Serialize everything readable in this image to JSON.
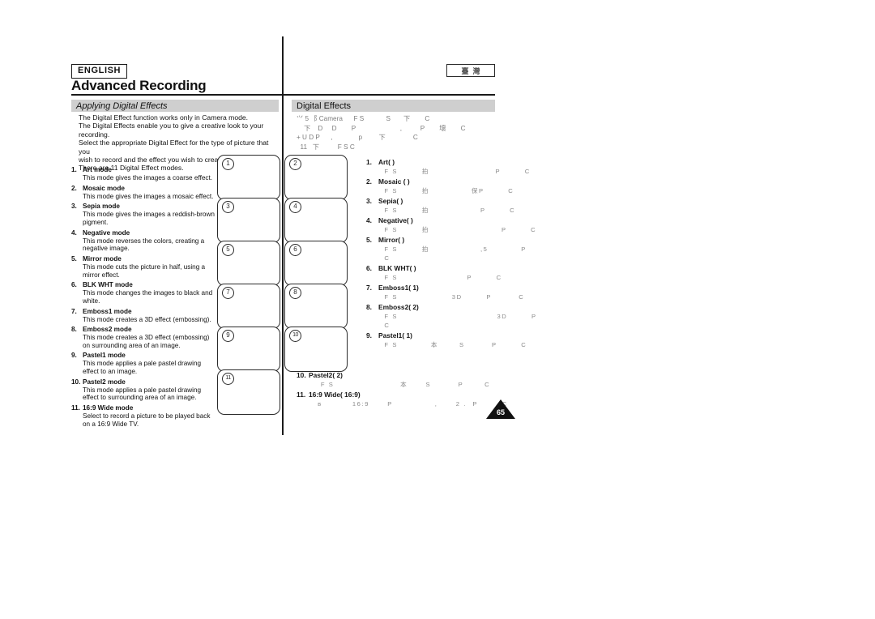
{
  "header": {
    "language_badge": "ENGLISH",
    "region_badge_chars": [
      "臺",
      "灣"
    ],
    "chapter_title": "Advanced Recording"
  },
  "left_column": {
    "section_bar": "Applying Digital Effects",
    "intro_lines": [
      "The Digital Effect function works only in Camera mode.",
      "The Digital Effects enable you to give a creative look to your",
      "recording.",
      "Select the appropriate Digital Effect for the type of picture that you",
      "wish to record and the effect you wish to create.",
      "There are 11 Digital Effect modes."
    ],
    "modes": [
      {
        "num": "1.",
        "name": "Art mode",
        "desc": "This mode gives the images a coarse effect."
      },
      {
        "num": "2.",
        "name": "Mosaic mode",
        "desc": "This mode gives the images a mosaic effect."
      },
      {
        "num": "3.",
        "name": "Sepia mode",
        "desc": "This mode gives the images a reddish-brown pigment."
      },
      {
        "num": "4.",
        "name": "Negative mode",
        "desc": "This mode reverses the colors, creating a negative image."
      },
      {
        "num": "5.",
        "name": "Mirror mode",
        "desc": "This mode cuts the picture in half, using a mirror effect."
      },
      {
        "num": "6.",
        "name": "BLK   WHT mode",
        "desc": "This mode changes the images to black and white."
      },
      {
        "num": "7.",
        "name": "Emboss1 mode",
        "desc": "This mode creates a 3D effect (embossing)."
      },
      {
        "num": "8.",
        "name": "Emboss2 mode",
        "desc": "This mode creates a 3D effect (embossing) on surrounding area of an image."
      },
      {
        "num": "9.",
        "name": "Pastel1 mode",
        "desc": "This mode applies a pale pastel drawing effect to an image."
      },
      {
        "num": "10.",
        "name": "Pastel2 mode",
        "desc": "This mode applies a pale pastel drawing effect to surrounding area of an image."
      },
      {
        "num": "11.",
        "name": "16:9 Wide mode",
        "desc": "Select to record a picture to be played back on a 16:9 Wide TV."
      }
    ]
  },
  "screenshots": [
    {
      "label": "1"
    },
    {
      "label": "2"
    },
    {
      "label": "3"
    },
    {
      "label": "4"
    },
    {
      "label": "5"
    },
    {
      "label": "6"
    },
    {
      "label": "7"
    },
    {
      "label": "8"
    },
    {
      "label": "9"
    },
    {
      "label": "10"
    },
    {
      "label": "11"
    }
  ],
  "right_column": {
    "section_bar": "Digital Effects",
    "intro_fragments": [
      "⺍ 5 ⻏ Camera      F S            S       下        C",
      "    下    D     D        P                        ,          P        壞        C",
      "+ U D P      ,              p         下               C",
      "  11   下          F S C"
    ],
    "modes": [
      {
        "num": "1.",
        "name": "Art(      )",
        "desc": "  F S        拍                      P        C"
      },
      {
        "num": "2.",
        "name": "Mosaic (        )",
        "desc": "  F S        拍              保P        C"
      },
      {
        "num": "3.",
        "name": "Sepia(     )",
        "desc": "  F S        拍                 P        C"
      },
      {
        "num": "4.",
        "name": "Negative(     )",
        "desc": "  F S        拍                        P        C"
      },
      {
        "num": "5.",
        "name": "Mirror(     )",
        "desc": "  F S        拍                 ,5           P\n  C"
      },
      {
        "num": "6.",
        "name": "BLK   WHT(     )",
        "desc": "  F S                       P        C"
      },
      {
        "num": "7.",
        "name": "Emboss1(      1)",
        "desc": "  F S                  3D        P         C"
      },
      {
        "num": "8.",
        "name": "Emboss2(      2)",
        "desc": "  F S                                 3D        P\n  C"
      },
      {
        "num": "9.",
        "name": "Pastel1(      1)",
        "desc": "  F S           本       S         P        C"
      }
    ],
    "modes_lower": [
      {
        "num": "10.",
        "name": "Pastel2(      2)",
        "desc": "    F S                      本      S         P       C"
      },
      {
        "num": "11.",
        "name": "16:9 Wide(        16:9)",
        "desc": "   ʙ          16:9      P              ,      2 .  P        C"
      }
    ]
  },
  "page_number": "65"
}
